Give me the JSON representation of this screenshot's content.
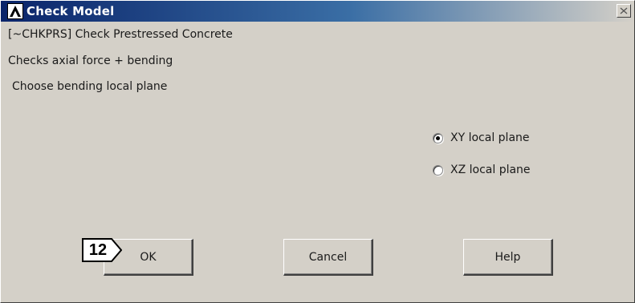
{
  "window": {
    "title": "Check Model",
    "app_icon": "ansys-logo-icon",
    "close_icon": "close-icon"
  },
  "content": {
    "command_line": "[~CHKPRS] Check Prestressed Concrete",
    "description": "Checks axial force + bending",
    "prompt": "Choose bending local plane"
  },
  "options": [
    {
      "label": "XY local plane",
      "selected": true
    },
    {
      "label": "XZ local plane",
      "selected": false
    }
  ],
  "buttons": {
    "ok": "OK",
    "cancel": "Cancel",
    "help": "Help"
  },
  "annotation": {
    "step_number": "12"
  }
}
